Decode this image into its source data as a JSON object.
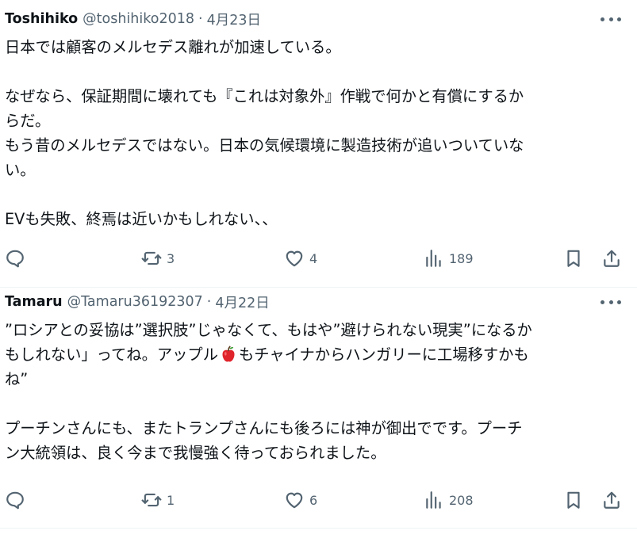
{
  "tweets": [
    {
      "name": "Toshihiko",
      "handle": "@toshihiko2018",
      "separator": "·",
      "date": "4月23日",
      "text": "日本では顧客のメルセデス離れが加速している。\n\nなぜなら、保証期間に壊れても『これは対象外』作戦で何かと有償にするか\nらだ。\nもう昔のメルセデスではない。日本の気候環境に製造技術が追いついていな\nい。\n\nEVも失敗、終焉は近いかもしれない、、",
      "stats": {
        "replies": "",
        "retweets": "3",
        "likes": "4",
        "views": "189"
      }
    },
    {
      "name": "Tamaru",
      "handle": "@Tamaru36192307",
      "separator": "·",
      "date": "4月22日",
      "text_before_emoji": "”ロシアとの妥協は”選択肢”じゃなくて、もはや”避けられない現実”になるか\nもしれない」ってね。アップル",
      "emoji": "🍎",
      "text_after_emoji": "もチャイナからハンガリーに工場移すかも\nね”\n\nプーチンさんにも、またトランプさんにも後ろには神が御出でです。プーチ\nン大統領は、良く今まで我慢強く待っておられました。",
      "stats": {
        "replies": "",
        "retweets": "1",
        "likes": "6",
        "views": "208"
      }
    }
  ],
  "icons": {
    "more": "more-horizontal-icon",
    "reply": "reply-icon",
    "retweet": "retweet-icon",
    "like": "heart-icon",
    "views": "views-bar-chart-icon",
    "bookmark": "bookmark-icon",
    "share": "share-icon"
  },
  "colors": {
    "text": "#0f1419",
    "secondary": "#536471",
    "divider": "#eff3f4",
    "apple": "#e0242b"
  }
}
